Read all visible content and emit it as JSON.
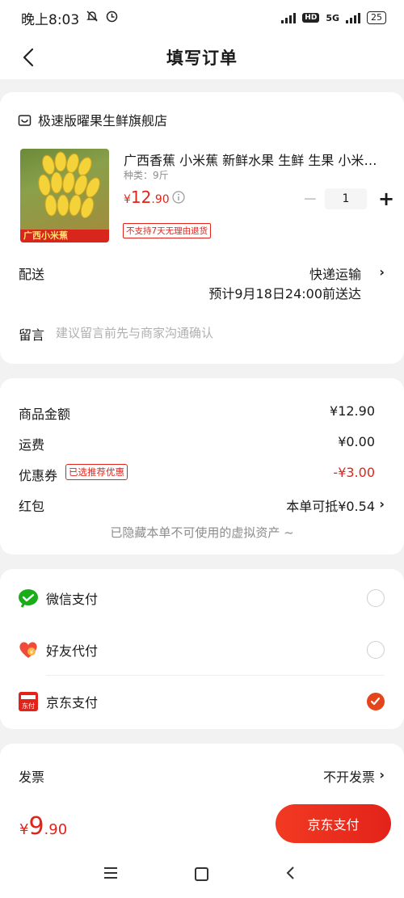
{
  "status": {
    "time": "晚上8:03",
    "network": "5G",
    "hd": "HD",
    "battery": "25"
  },
  "nav": {
    "title": "填写订单"
  },
  "shop": {
    "name": "极速版曜果生鲜旗舰店"
  },
  "product": {
    "title": "广西香蕉 小米蕉   新鲜水果 生鲜 生果 小米香蕉",
    "spec": "种类：9斤",
    "image_tag": "广西小米蕉",
    "price_symbol": "¥",
    "price_int": "12",
    "price_dec": ".90",
    "quantity": "1",
    "minus": "−",
    "plus": "+",
    "return_policy": "不支持7天无理由退货"
  },
  "delivery": {
    "label": "配送",
    "method": "快递运输",
    "eta": "预计9月18日24:00前送达"
  },
  "remark": {
    "label": "留言",
    "placeholder": "建议留言前先与商家沟通确认"
  },
  "summary": {
    "goods_label": "商品金额",
    "goods_value": "¥12.90",
    "shipping_label": "运费",
    "shipping_value": "¥0.00",
    "coupon_label": "优惠券",
    "coupon_tag": "已选推荐优惠",
    "coupon_value": "-¥3.00",
    "redpacket_label": "红包",
    "redpacket_value": "本单可抵¥0.54",
    "hidden_assets": "已隐藏本单不可使用的虚拟资产 ~"
  },
  "payment": {
    "options": [
      {
        "label": "微信支付",
        "selected": false
      },
      {
        "label": "好友代付",
        "selected": false
      },
      {
        "label": "京东支付",
        "selected": true
      }
    ],
    "jd_icon_text": "东付"
  },
  "invoice": {
    "label": "发票",
    "value": "不开发票"
  },
  "bottom": {
    "total_symbol": "¥",
    "total_int": "9",
    "total_dec": ".90",
    "pay_button": "京东支付"
  },
  "chevron": "›",
  "colors": {
    "accent": "#e2231a",
    "wechat_green": "#1aad19"
  }
}
